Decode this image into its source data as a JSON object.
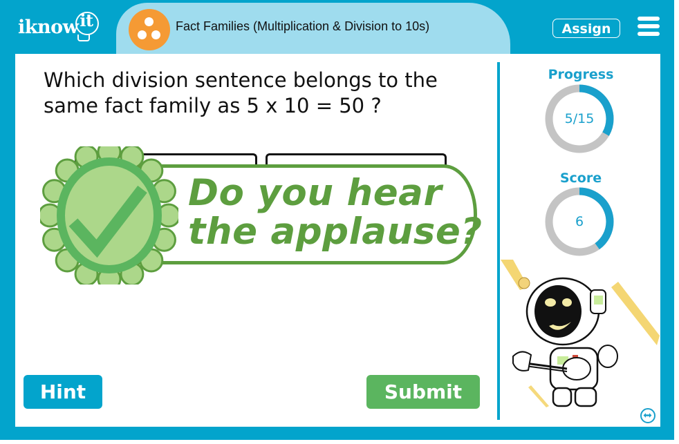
{
  "header": {
    "logo_text": "iknow",
    "logo_suffix": "it",
    "title": "Fact Families (Multiplication & Division to 10s)",
    "assign_label": "Assign",
    "menu_icon": "hamburger-menu-icon",
    "topic_icon": "three-dots-circle-icon"
  },
  "question": {
    "line1": "Which division sentence belongs to the",
    "line2": "same fact family as 5 x 10 = 50 ?"
  },
  "feedback": {
    "line1": "Do you hear",
    "line2": "the applause?",
    "icon": "checkmark-badge-icon"
  },
  "stats": {
    "progress": {
      "label": "Progress",
      "value_text": "5/15",
      "current": 5,
      "total": 15,
      "fraction": 0.3333
    },
    "score": {
      "label": "Score",
      "value_text": "6",
      "fraction": 0.4
    }
  },
  "buttons": {
    "hint_label": "Hint",
    "submit_label": "Submit"
  },
  "colors": {
    "brand_blue": "#03a4cc",
    "header_light": "#9fdcee",
    "topic_orange": "#f59a34",
    "success_green": "#5d9e3f",
    "submit_green": "#5bb55f",
    "ring_gray": "#c4c4c4",
    "ring_blue": "#1aa0cc"
  },
  "footer": {
    "toggle_icon": "swap-horizontal-icon"
  }
}
